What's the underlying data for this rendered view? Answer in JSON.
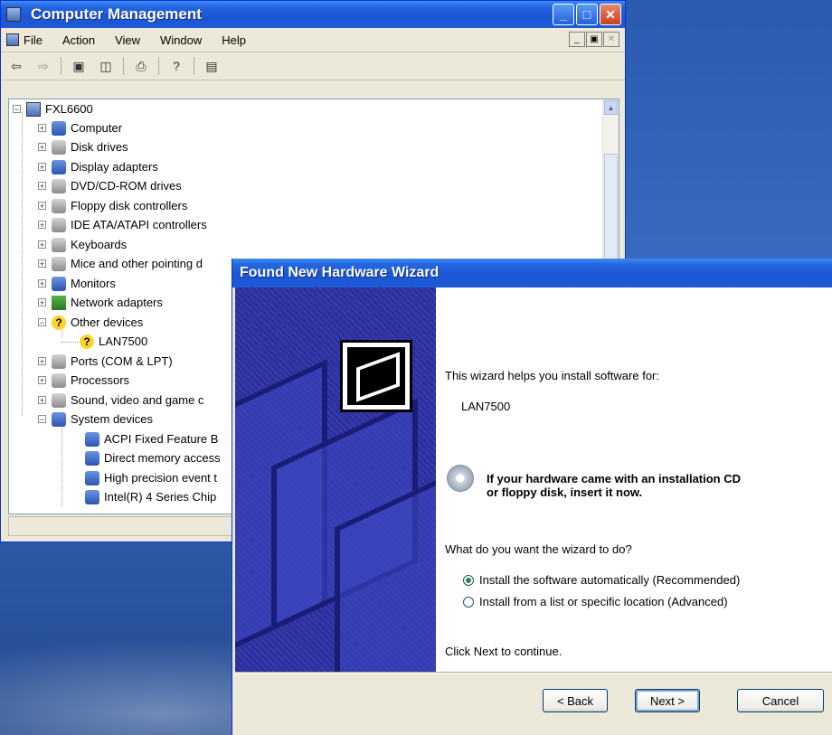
{
  "cm": {
    "title": "Computer Management",
    "menu": [
      "File",
      "Action",
      "View",
      "Window",
      "Help"
    ],
    "tree": {
      "root": "FXL6600",
      "items": [
        "Computer",
        "Disk drives",
        "Display adapters",
        "DVD/CD-ROM drives",
        "Floppy disk controllers",
        "IDE ATA/ATAPI controllers",
        "Keyboards",
        "Mice and other pointing d",
        "Monitors",
        "Network adapters",
        "Other devices",
        "LAN7500",
        "Ports (COM & LPT)",
        "Processors",
        "Sound, video and game c",
        "System devices",
        "ACPI Fixed Feature B",
        "Direct memory access",
        "High precision event t",
        "Intel(R) 4 Series Chip"
      ]
    }
  },
  "wizard": {
    "title": "Found New Hardware Wizard",
    "intro": "This wizard helps you install software for:",
    "device": "LAN7500",
    "cd_line1": "If your hardware came with an installation CD",
    "cd_line2": "or floppy disk, insert it now.",
    "question": "What do you want the wizard to do?",
    "option_auto": "Install the software automatically (Recommended)",
    "option_list": "Install from a list or specific location (Advanced)",
    "selected_option": "option_auto",
    "continue_text": "Click Next to continue.",
    "back_label": "< Back",
    "next_label": "Next >",
    "cancel_label": "Cancel"
  }
}
